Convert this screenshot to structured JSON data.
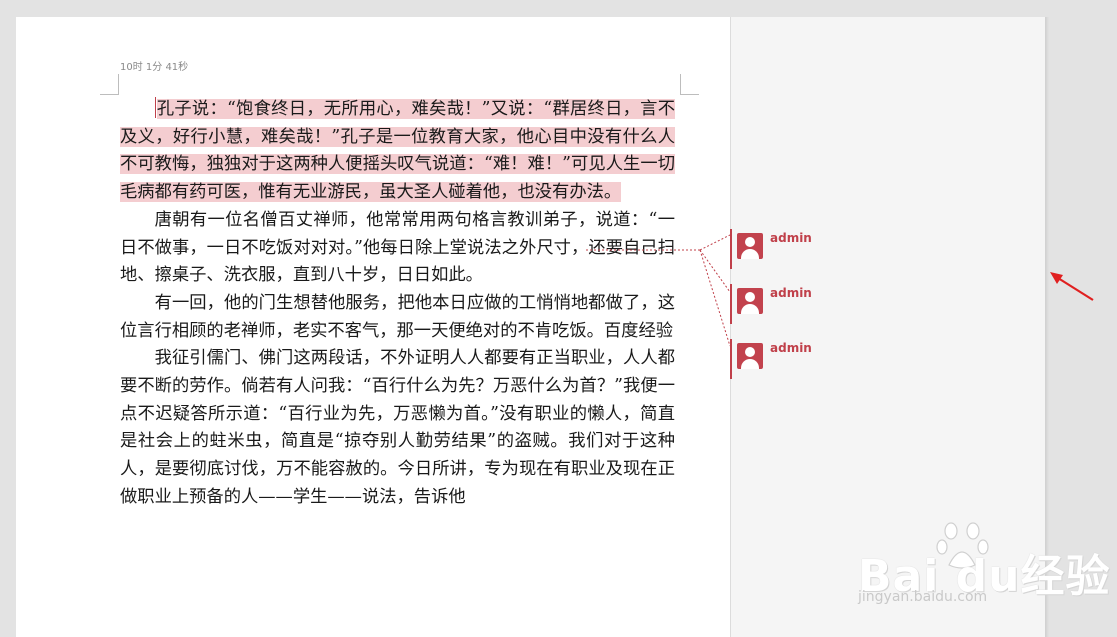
{
  "page": {
    "header_text": "10时 1分 41秒",
    "paragraphs": [
      "孔子说：“饱食终日，无所用心，难矣哉！”又说：“群居终日，言不及义，好行小慧，难矣哉！”孔子是一位教育大家，他心目中没有什么人不可教悔，独独对于这两种人便摇头叹气说道：“难！难！”可见人生一切毛病都有药可医，惟有无业游民，虽大圣人碰着他，也没有办法。",
      "唐朝有一位名僧百丈禅师，他常常用两句格言教训弟子，说道：“一日不做事，一日不吃饭对对对。”他每日除上堂说法之外尺寸，还要自己扫地、擦桌子、洗衣服，直到八十岁，日日如此。",
      "有一回，他的门生想替他服务，把他本日应做的工悄悄地都做了，这位言行相顾的老禅师，老实不客气，那一天便绝对的不肯吃饭。百度经验",
      "我征引儒门、佛门这两段话，不外证明人人都要有正当职业，人人都要不断的劳作。倘若有人问我：“百行什么为先？万恶什么为首？”我便一点不迟疑答所示道：“百行业为先，万恶懒为首。”没有职业的懒人，简直是社会上的蛀米虫，简直是“掠夺别人勤劳结果”的盗贼。我们对于这种人，是要彻底讨伐，万不能容赦的。今日所讲，专为现在有职业及现在正做职业上预备的人——学生——说法，告诉他"
    ]
  },
  "comments": [
    {
      "author": "admin"
    },
    {
      "author": "admin"
    },
    {
      "author": "admin"
    }
  ],
  "watermark": {
    "logo": "Bai  du经验",
    "url": "jingyan.baidu.com"
  },
  "colors": {
    "highlight": "#f4cdd0",
    "comment_accent": "#c0404a",
    "arrow": "#e02020"
  }
}
